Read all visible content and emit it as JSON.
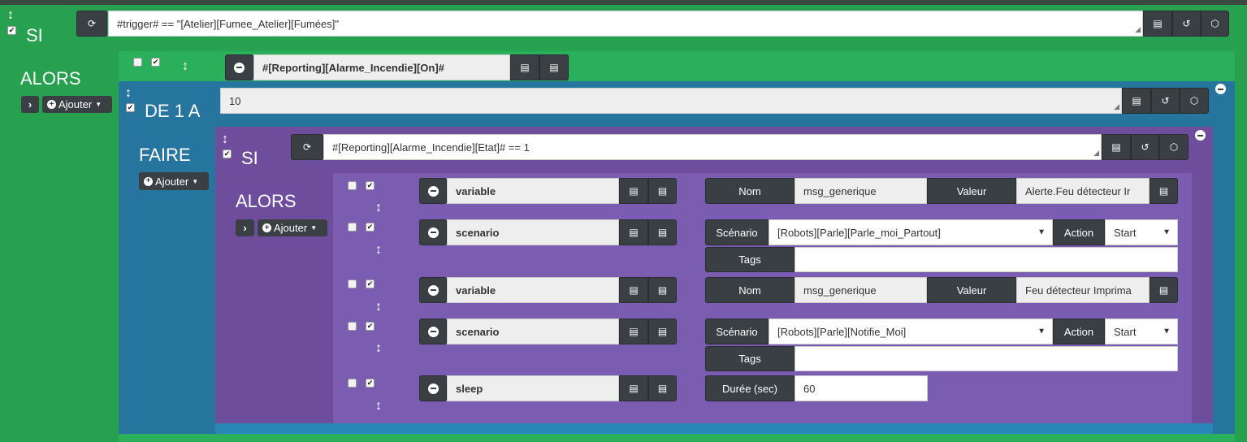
{
  "root_if": {
    "title": "SI",
    "condition": "#trigger# == \"[Atelier][Fumee_Atelier][Fumées]\""
  },
  "root_then": {
    "title": "ALORS",
    "add_label": "Ajouter"
  },
  "green_action": {
    "expression": "#[Reporting][Alarme_Incendie][On]#"
  },
  "for_block": {
    "title": "DE 1 A",
    "count": "10",
    "do_title": "FAIRE",
    "add_label": "Ajouter"
  },
  "inner_if": {
    "title": "SI",
    "condition": "#[Reporting][Alarme_Incendie][Etat]# == 1",
    "then_title": "ALORS",
    "add_label": "Ajouter"
  },
  "actions": [
    {
      "type": "variable",
      "name_label": "Nom",
      "name_value": "msg_generique",
      "value_label": "Valeur",
      "value_value": "Alerte.Feu détecteur Ir"
    },
    {
      "type": "scenario",
      "scenario_label": "Scénario",
      "scenario_value": "[Robots][Parle][Parle_moi_Partout]",
      "action_label": "Action",
      "action_value": "Start",
      "tags_label": "Tags"
    },
    {
      "type": "variable",
      "name_label": "Nom",
      "name_value": "msg_generique",
      "value_label": "Valeur",
      "value_value": "Feu détecteur Imprima"
    },
    {
      "type": "scenario",
      "scenario_label": "Scénario",
      "scenario_value": "[Robots][Parle][Notifie_Moi]",
      "action_label": "Action",
      "action_value": "Start",
      "tags_label": "Tags"
    },
    {
      "type": "sleep",
      "duration_label": "Durée (sec)",
      "duration_value": "60"
    }
  ],
  "icons": {
    "refresh": "refresh-icon",
    "list": "list-icon",
    "history": "history-icon",
    "cube": "cube-icon",
    "minus": "minus-circle-icon",
    "plus": "plus-circle-icon",
    "chevron": "chevron-right-icon",
    "move": "move-vertical-icon"
  },
  "colors": {
    "green": "#27a150",
    "blue": "#26759e",
    "purple": "#6e4e9c",
    "inner_purple": "#7a5cb1",
    "dark_button": "#3a3f44"
  }
}
